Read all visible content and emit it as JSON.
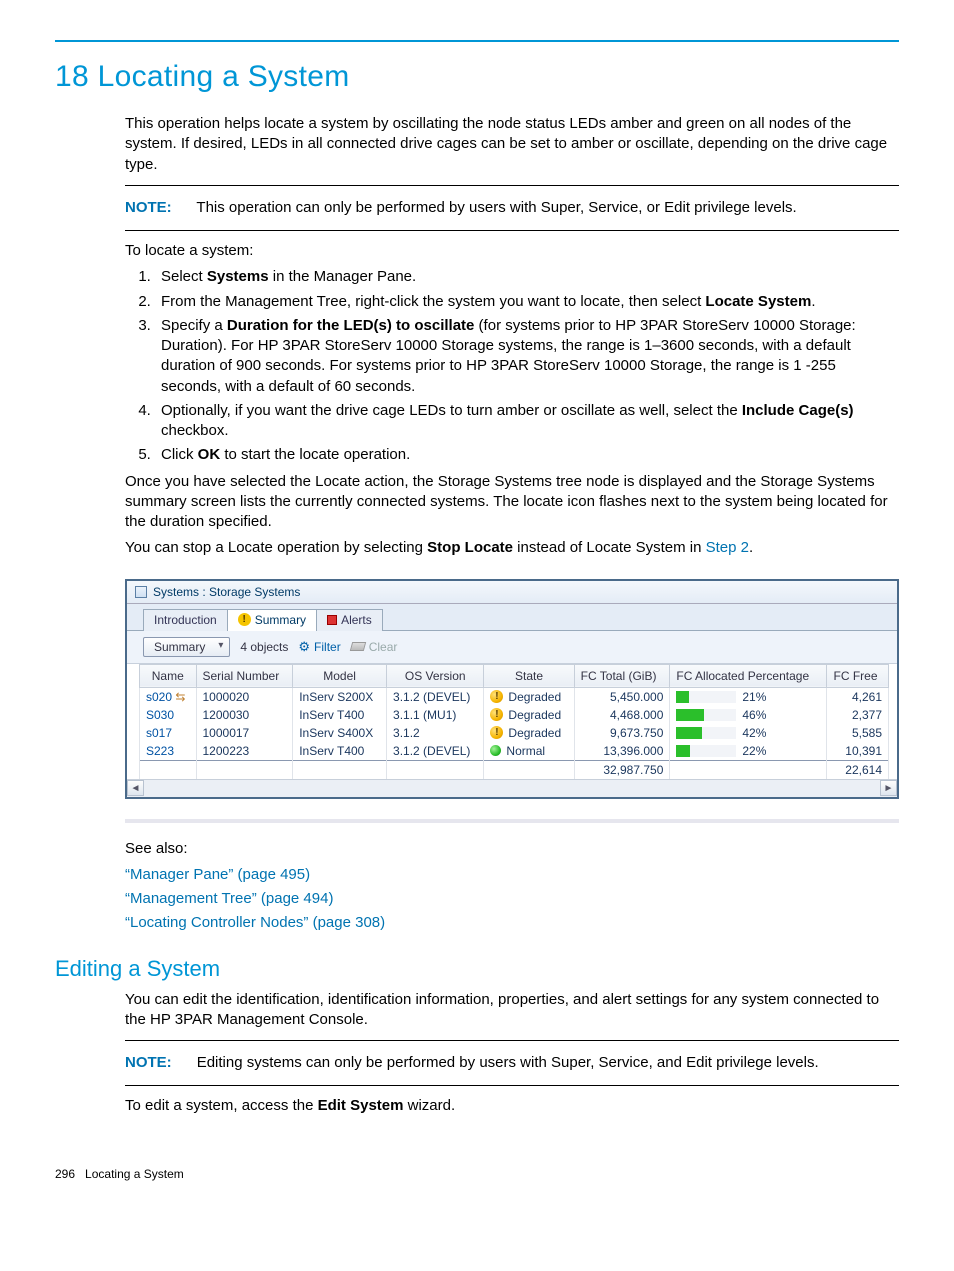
{
  "chapter": {
    "number": "18",
    "title": "Locating a System"
  },
  "intro": "This operation helps locate a system by oscillating the node status LEDs amber and green on all nodes of the system. If desired, LEDs in all connected drive cages can be set to amber or oscillate, depending on the drive cage type.",
  "note1": {
    "label": "NOTE:",
    "text": "This operation can only be performed by users with Super, Service, or Edit privilege levels."
  },
  "lead": "To locate a system:",
  "steps": [
    {
      "pre": "Select ",
      "bold": "Systems",
      "post": " in the Manager Pane."
    },
    {
      "pre": "From the Management Tree, right-click the system you want to locate, then select ",
      "bold": "Locate System",
      "post": "."
    },
    {
      "pre": "Specify a ",
      "bold": "Duration for the LED(s) to oscillate",
      "post": " (for systems prior to HP 3PAR StoreServ 10000 Storage: Duration). For HP 3PAR StoreServ 10000 Storage systems, the range is 1–3600 seconds, with a default duration of 900 seconds. For systems prior to HP 3PAR StoreServ 10000 Storage, the range is 1 -255 seconds, with a default of 60 seconds."
    },
    {
      "pre": "Optionally, if you want the drive cage LEDs to turn amber or oscillate as well, select the ",
      "bold": "Include Cage(s)",
      "post": " checkbox."
    },
    {
      "pre": "Click ",
      "bold": "OK",
      "post": " to start the locate operation."
    }
  ],
  "after_steps": "Once you have selected the Locate action, the Storage Systems tree node is displayed and the Storage Systems summary screen lists the currently connected systems. The locate icon flashes next to the system being located for the duration specified.",
  "stop_locate": {
    "pre": "You can stop a Locate operation by selecting ",
    "bold": "Stop Locate",
    "mid": " instead of Locate System in ",
    "link": "Step 2",
    "post": "."
  },
  "shot": {
    "title": "Systems : Storage Systems",
    "tabs": {
      "intro": "Introduction",
      "summary": "Summary",
      "alerts": "Alerts"
    },
    "toolbar": {
      "selector": "Summary",
      "count": "4 objects",
      "filter": "Filter",
      "clear": "Clear"
    },
    "columns": {
      "name": "Name",
      "serial": "Serial Number",
      "model": "Model",
      "os": "OS Version",
      "state": "State",
      "fctotal": "FC Total (GiB)",
      "fcalloc": "FC Allocated Percentage",
      "fcfree": "FC Free"
    },
    "rows": [
      {
        "name": "s020",
        "locating": true,
        "serial": "1000020",
        "model": "InServ S200X",
        "os": "3.1.2 (DEVEL)",
        "state": "Degraded",
        "state_kind": "warn",
        "fctotal": "5,450.000",
        "pct": 21,
        "pct_label": "21%",
        "fcfree": "4,261"
      },
      {
        "name": "S030",
        "locating": false,
        "serial": "1200030",
        "model": "InServ T400",
        "os": "3.1.1 (MU1)",
        "state": "Degraded",
        "state_kind": "warn",
        "fctotal": "4,468.000",
        "pct": 46,
        "pct_label": "46%",
        "fcfree": "2,377"
      },
      {
        "name": "s017",
        "locating": false,
        "serial": "1000017",
        "model": "InServ S400X",
        "os": "3.1.2",
        "state": "Degraded",
        "state_kind": "warn",
        "fctotal": "9,673.750",
        "pct": 42,
        "pct_label": "42%",
        "fcfree": "5,585"
      },
      {
        "name": "S223",
        "locating": false,
        "serial": "1200223",
        "model": "InServ T400",
        "os": "3.1.2 (DEVEL)",
        "state": "Normal",
        "state_kind": "ok",
        "fctotal": "13,396.000",
        "pct": 22,
        "pct_label": "22%",
        "fcfree": "10,391"
      }
    ],
    "totals": {
      "fctotal": "32,987.750",
      "fcfree": "22,614"
    }
  },
  "seealso_label": "See also:",
  "seealso": [
    "“Manager Pane” (page 495)",
    "“Management Tree” (page 494)",
    "“Locating Controller Nodes” (page 308)"
  ],
  "edit": {
    "title": "Editing a System",
    "p1": "You can edit the identification, identification information, properties, and alert settings for any system connected to the HP 3PAR Management Console.",
    "note": {
      "label": "NOTE:",
      "text": "Editing systems can only be performed by users with Super, Service, and Edit privilege levels."
    },
    "p2_pre": "To edit a system, access the ",
    "p2_bold": "Edit System",
    "p2_post": " wizard."
  },
  "footer": {
    "page": "296",
    "title": "Locating a System"
  }
}
